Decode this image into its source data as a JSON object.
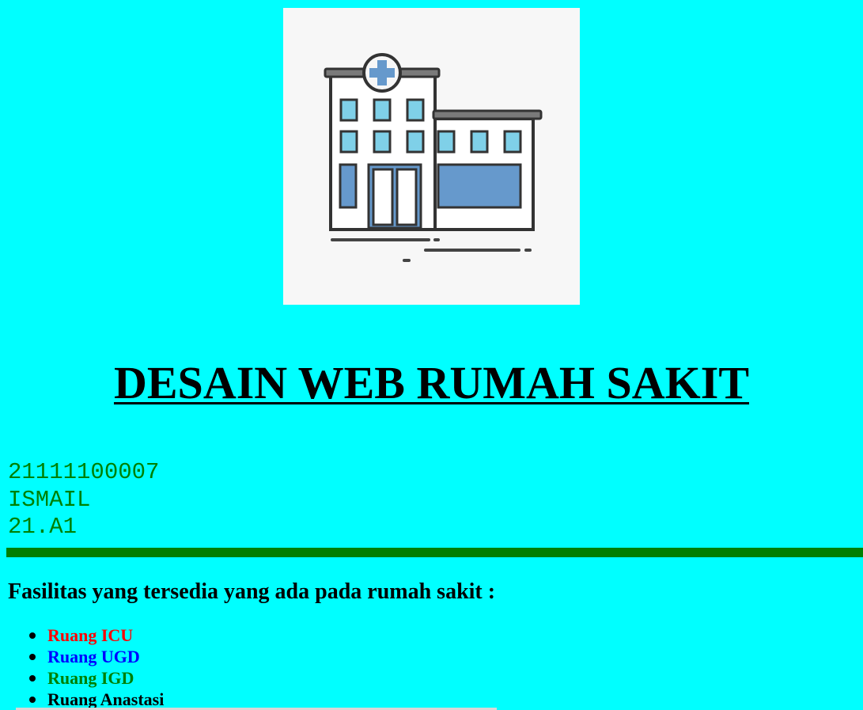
{
  "hero": {
    "icon": "hospital-building-icon"
  },
  "page": {
    "title": "DESAIN WEB RUMAH SAKIT"
  },
  "identity": {
    "nim": "21111100007",
    "name": "ISMAIL",
    "class": "21.A1",
    "color": "#008000"
  },
  "facilities": {
    "heading": "Fasilitas yang tersedia yang ada pada rumah sakit :",
    "items": [
      {
        "label": "Ruang ICU",
        "color": "#ff0000"
      },
      {
        "label": "Ruang UGD",
        "color": "#0000ff"
      },
      {
        "label": "Ruang IGD",
        "color": "#008000"
      },
      {
        "label": "Ruang Anastasi",
        "color": "#000000"
      }
    ]
  },
  "colors": {
    "background": "#00ffff",
    "divider": "#008000"
  }
}
